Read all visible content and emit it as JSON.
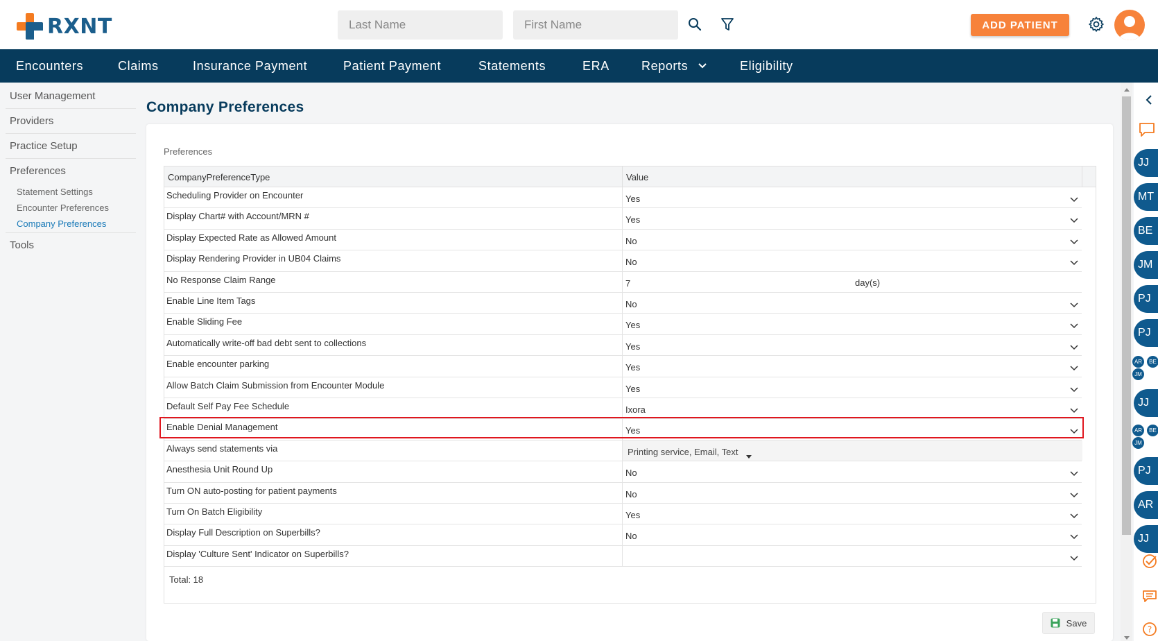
{
  "app": {
    "logo_text": "RXNT"
  },
  "header": {
    "last_name_placeholder": "Last Name",
    "first_name_placeholder": "First Name",
    "add_patient_label": "ADD PATIENT"
  },
  "nav": {
    "items": [
      "Encounters",
      "Claims",
      "Insurance Payment",
      "Patient Payment",
      "Statements",
      "ERA",
      "Reports",
      "Eligibility"
    ]
  },
  "sidebar": {
    "items": [
      "User Management",
      "Providers",
      "Practice Setup",
      "Preferences",
      "Tools"
    ],
    "sub_items": [
      "Statement Settings",
      "Encounter Preferences",
      "Company Preferences"
    ],
    "active_sub": "Company Preferences"
  },
  "main": {
    "page_title": "Company Preferences",
    "section_label": "Preferences",
    "columns": [
      "CompanyPreferenceType",
      "Value"
    ],
    "rows": [
      {
        "name": "Scheduling Provider on Encounter",
        "value": "Yes"
      },
      {
        "name": "Display Chart# with Account/MRN #",
        "value": "Yes"
      },
      {
        "name": "Display Expected Rate as Allowed Amount",
        "value": "No"
      },
      {
        "name": "Display Rendering Provider in UB04 Claims",
        "value": "No"
      },
      {
        "name": "No Response Claim Range",
        "value": "7",
        "unit": "day(s)"
      },
      {
        "name": "Enable Line Item Tags",
        "value": "No"
      },
      {
        "name": "Enable Sliding Fee",
        "value": "Yes"
      },
      {
        "name": "Automatically write-off bad debt sent to collections",
        "value": "Yes"
      },
      {
        "name": "Enable encounter parking",
        "value": "Yes"
      },
      {
        "name": "Allow Batch Claim Submission from Encounter Module",
        "value": "Yes"
      },
      {
        "name": "Default Self Pay Fee Schedule",
        "value": "Ixora"
      },
      {
        "name": "Enable Denial Management",
        "value": "Yes"
      },
      {
        "name": "Always send statements via",
        "value": "Printing service,  Email,  Text"
      },
      {
        "name": "Anesthesia Unit Round Up",
        "value": "No"
      },
      {
        "name": "Turn ON auto-posting for patient payments",
        "value": "No"
      },
      {
        "name": "Turn On Batch Eligibility",
        "value": "Yes"
      },
      {
        "name": "Display Full Description on Superbills?",
        "value": "No"
      },
      {
        "name": "Display 'Culture Sent' Indicator on Superbills?",
        "value": ""
      }
    ],
    "total_label": "Total: 18",
    "save_label": "Save"
  },
  "rail": {
    "avatars": [
      "JJ",
      "MT",
      "BE",
      "JM",
      "PJ",
      "PJ",
      "JJ",
      "PJ",
      "AR",
      "JJ"
    ],
    "mini_groups": [
      [
        "AR",
        "BE",
        "JM"
      ],
      [
        "AR",
        "BE",
        "JM"
      ]
    ]
  },
  "colors": {
    "accent": "#f7823a",
    "nav_bg": "#073b5c",
    "highlight": "#e0161e",
    "brand_blue": "#1b5e8c"
  }
}
